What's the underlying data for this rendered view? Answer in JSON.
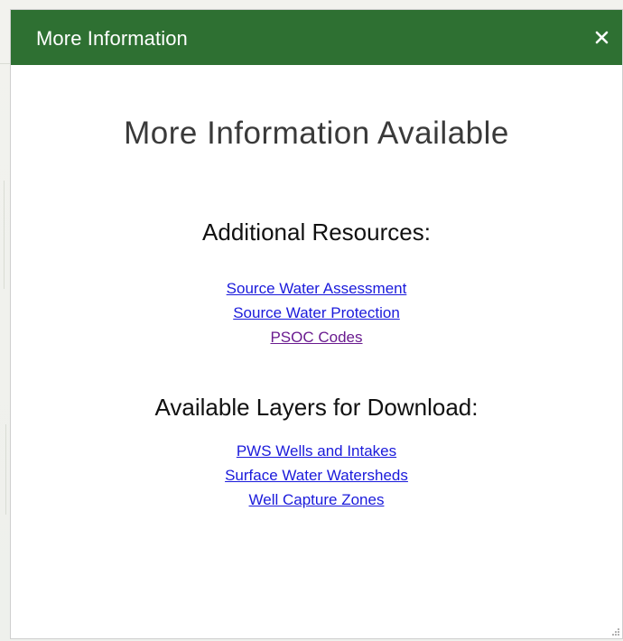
{
  "dialog": {
    "title": "More Information",
    "close_icon": "close-icon",
    "close_glyph": "×"
  },
  "content": {
    "main_heading": "More Information Available",
    "resources": {
      "heading": "Additional Resources:",
      "links": [
        {
          "label": "Source Water Assessment"
        },
        {
          "label": "Source Water Protection"
        },
        {
          "label": "PSOC Codes"
        }
      ]
    },
    "layers": {
      "heading": "Available Layers for Download:",
      "links": [
        {
          "label": "PWS Wells and Intakes"
        },
        {
          "label": "Surface Water Watersheds"
        },
        {
          "label": "Well Capture Zones"
        }
      ]
    }
  },
  "colors": {
    "header": "#2e7032",
    "link": "#1a1adb",
    "visited_link": "#6a1b8f"
  }
}
